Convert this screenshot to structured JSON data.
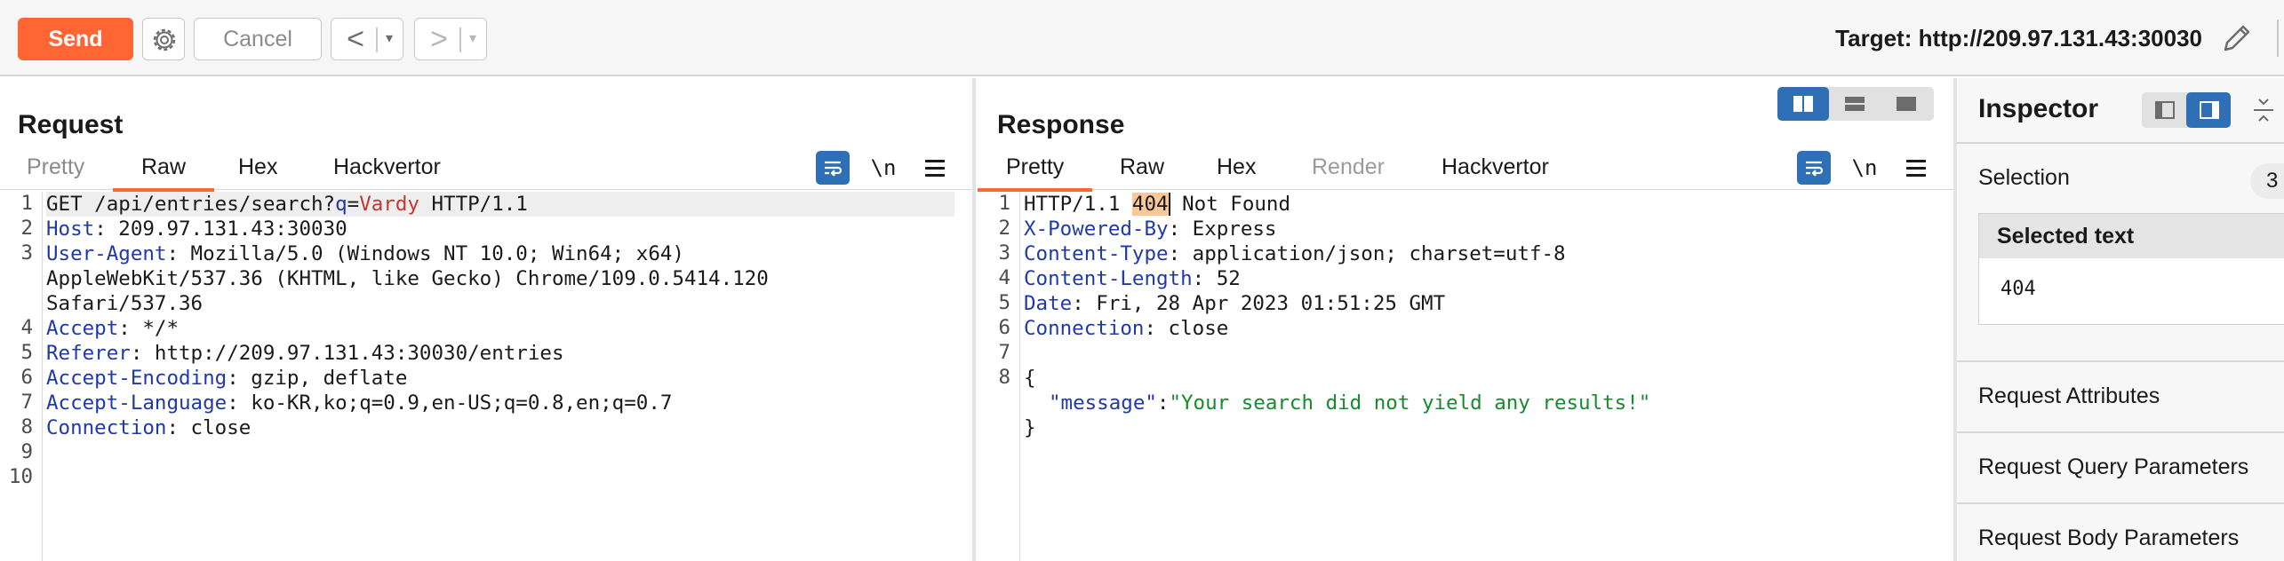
{
  "toolbar": {
    "send_label": "Send",
    "cancel_label": "Cancel",
    "back_symbol": "<",
    "forward_symbol": ">",
    "dropdown_symbol": "▾",
    "target_label": "Target: http://209.97.131.43:30030",
    "accent_color": "#ff6633"
  },
  "request": {
    "title": "Request",
    "tabs": [
      {
        "label": "Pretty",
        "state": "dim"
      },
      {
        "label": "Raw",
        "state": "active"
      },
      {
        "label": "Hex",
        "state": "normal"
      },
      {
        "label": "Hackvertor",
        "state": "normal"
      }
    ],
    "newline_toggle": "\\n",
    "line_numbers": [
      "1",
      "2",
      "3",
      "",
      "",
      "4",
      "5",
      "6",
      "7",
      "8",
      "9",
      "10"
    ],
    "lines": {
      "l1_method": "GET /api/entries/search?",
      "l1_qkey": "q",
      "l1_eq": "=",
      "l1_qval": "Vardy",
      "l1_proto": " HTTP/1.1",
      "host_k": "Host",
      "host_v": ": 209.97.131.43:30030",
      "ua_k": "User-Agent",
      "ua_v": ": Mozilla/5.0 (Windows NT 10.0; Win64; x64)",
      "ua_v2": "AppleWebKit/537.36 (KHTML, like Gecko) Chrome/109.0.5414.120",
      "ua_v3": "Safari/537.36",
      "accept_k": "Accept",
      "accept_v": ": */*",
      "referer_k": "Referer",
      "referer_v": ": http://209.97.131.43:30030/entries",
      "ae_k": "Accept-Encoding",
      "ae_v": ": gzip, deflate",
      "al_k": "Accept-Language",
      "al_v": ": ko-KR,ko;q=0.9,en-US;q=0.8,en;q=0.7",
      "conn_k": "Connection",
      "conn_v": ": close"
    }
  },
  "response": {
    "title": "Response",
    "tabs": [
      {
        "label": "Pretty",
        "state": "active"
      },
      {
        "label": "Raw",
        "state": "normal"
      },
      {
        "label": "Hex",
        "state": "normal"
      },
      {
        "label": "Render",
        "state": "disabled"
      },
      {
        "label": "Hackvertor",
        "state": "normal"
      }
    ],
    "newline_toggle": "\\n",
    "line_numbers": [
      "1",
      "2",
      "3",
      "4",
      "5",
      "6",
      "7",
      "8"
    ],
    "lines": {
      "status_pre": "HTTP/1.1 ",
      "status_code": "404",
      "status_post": " Not Found",
      "xpb_k": "X-Powered-By",
      "xpb_v": ": Express",
      "ct_k": "Content-Type",
      "ct_v": ": application/json; charset=utf-8",
      "cl_k": "Content-Length",
      "cl_v": ": 52",
      "date_k": "Date",
      "date_v": ": Fri, 28 Apr 2023 01:51:25 GMT",
      "conn_k": "Connection",
      "conn_v": ": close",
      "brace_open": "{",
      "json_key": "\"message\"",
      "json_colon": ":",
      "json_val": "\"Your search did not yield any results!\"",
      "brace_close": "}"
    }
  },
  "inspector": {
    "title": "Inspector",
    "selection_label": "Selection",
    "selection_count": "3",
    "selected_text_label": "Selected text",
    "selected_text_value": "404",
    "sections": [
      "Request Attributes",
      "Request Query Parameters",
      "Request Body Parameters"
    ]
  }
}
